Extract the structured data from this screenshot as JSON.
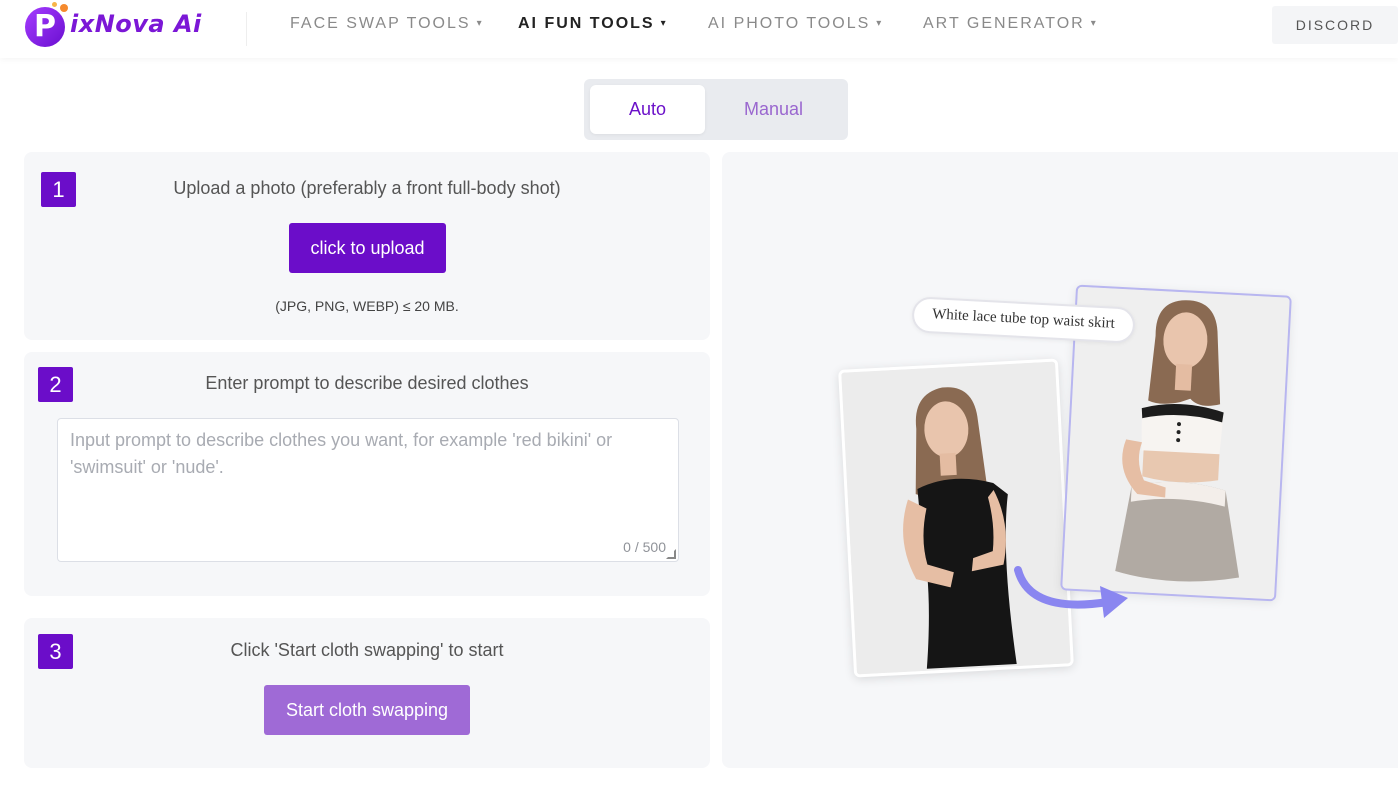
{
  "header": {
    "logo": {
      "badge_letter": "P",
      "text": "ixNova Ai"
    },
    "nav": [
      {
        "label": "FACE SWAP TOOLS",
        "active": false
      },
      {
        "label": "AI FUN TOOLS",
        "active": true
      },
      {
        "label": "AI PHOTO TOOLS",
        "active": false
      },
      {
        "label": "ART GENERATOR",
        "active": false
      }
    ],
    "nav_caret": "▾",
    "discord": "DISCORD"
  },
  "mode_toggle": {
    "auto": "Auto",
    "manual": "Manual",
    "selected": "Auto"
  },
  "steps": {
    "step1": {
      "number": "1",
      "title": "Upload a photo (preferably a front full-body shot)",
      "button": "click to upload",
      "formats": "(JPG, PNG, WEBP) ≤ 20 MB."
    },
    "step2": {
      "number": "2",
      "title": "Enter prompt to describe desired clothes",
      "placeholder": "Input prompt to describe clothes you want, for example 'red bikini' or 'swimsuit' or 'nude'.",
      "value": "",
      "counter": "0 / 500"
    },
    "step3": {
      "number": "3",
      "title": "Click 'Start cloth swapping' to start",
      "button": "Start cloth swapping"
    }
  },
  "preview": {
    "caption": "White lace tube top waist skirt"
  },
  "colors": {
    "brand_purple": "#6b0dc9",
    "start_button": "#9f6ad6",
    "panel_bg": "#f6f7f9",
    "arrow": "#8a86f0"
  }
}
